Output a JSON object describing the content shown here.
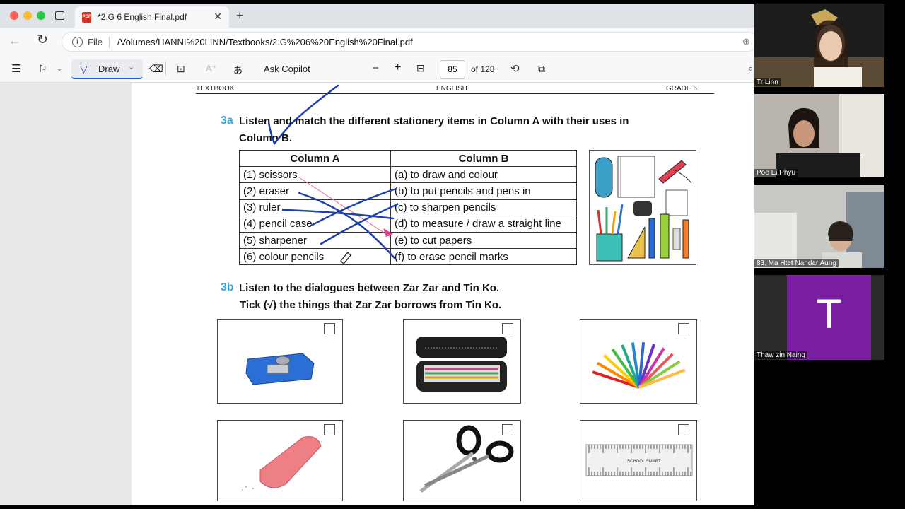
{
  "browser": {
    "tab_title": "*2.G 6 English Final.pdf",
    "new_tab": "+",
    "address": {
      "scheme_label": "File",
      "url": "/Volumes/HANNI%20LINN/Textbooks/2.G%206%20English%20Final.pdf"
    }
  },
  "toolbar": {
    "draw_label": "Draw",
    "ask_copilot": "Ask Copilot",
    "zoom_out": "−",
    "zoom_in": "+",
    "page_number": "85",
    "page_total": "of 128"
  },
  "pdf": {
    "header": {
      "left": "TEXTBOOK",
      "center": "ENGLISH",
      "right": "GRADE 6"
    },
    "q3a": {
      "number": "3a",
      "instruction_line1": "Listen and match the different stationery items in Column A with their uses in",
      "instruction_line2": "Column B.",
      "column_a_header": "Column A",
      "column_b_header": "Column B",
      "rows": [
        {
          "a": "(1) scissors",
          "b": "(a) to draw and colour"
        },
        {
          "a": "(2) eraser",
          "b": "(b) to put pencils and pens in"
        },
        {
          "a": "(3) ruler",
          "b": "(c) to sharpen pencils"
        },
        {
          "a": "(4) pencil case",
          "b": "(d) to measure / draw a straight line"
        },
        {
          "a": "(5) sharpener",
          "b": "(e) to cut papers"
        },
        {
          "a": "(6) colour pencils",
          "b": "(f) to erase pencil marks"
        }
      ]
    },
    "q3b": {
      "number": "3b",
      "instruction_line1": "Listen to the dialogues between Zar Zar  and Tin Ko.",
      "instruction_line2": "Tick (√) the things that Zar Zar borrows from Tin Ko.",
      "cards": [
        "sharpener",
        "pencil case",
        "colour pencils",
        "eraser",
        "scissors",
        "ruler"
      ],
      "ruler_text": "SCHOOL SMART"
    }
  },
  "participants": [
    {
      "name": "Tr Linn"
    },
    {
      "name": "Poe Ei Phyu"
    },
    {
      "name": "83. Ma Htet Nandar Aung"
    },
    {
      "name": "Thaw zin Naing",
      "initial": "T",
      "color": "#7b1fa2"
    }
  ]
}
